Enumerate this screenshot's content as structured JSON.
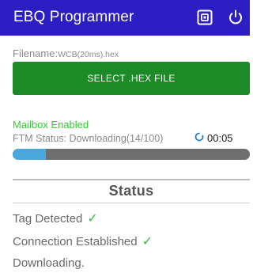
{
  "app": {
    "title": "EBQ Programmer",
    "icons": {
      "nfc": "nfc-tag-icon",
      "power": "power-icon"
    },
    "colors": {
      "appbar": "#2d1ec4",
      "button": "#1c8a26",
      "mailbox": "#2dd12d",
      "progress": "#4aa8dc",
      "check": "#33c23a"
    }
  },
  "file": {
    "label": "Filename:",
    "name": "WCB(20ms).hex",
    "select_button": "SELECT .HEX FILE"
  },
  "transfer": {
    "mailbox": "Mailbox Enabled",
    "ftm_status": "FTM Status: Downloading(14/100)",
    "timer": "00:05",
    "progress": 0.14
  },
  "status": {
    "heading": "Status",
    "lines": [
      {
        "text": "Tag Detected",
        "check": "✓"
      },
      {
        "text": "Connection Established",
        "check": "✓"
      },
      {
        "text": "Downloading.",
        "check": ""
      }
    ]
  }
}
